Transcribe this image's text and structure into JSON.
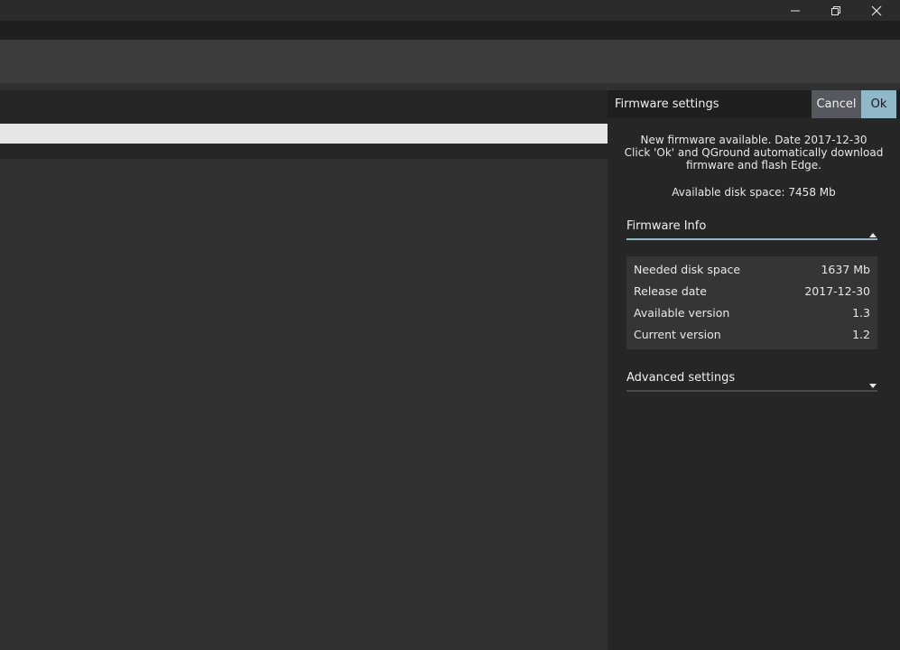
{
  "window": {
    "controls": [
      "minimize-icon",
      "restore-icon",
      "close-icon"
    ]
  },
  "firmware_panel": {
    "title": "Firmware settings",
    "cancel_label": "Cancel",
    "ok_label": "Ok",
    "message_line1": "New firmware available. Date 2017-12-30",
    "message_line2": "Click 'Ok' and QGround automatically download",
    "message_line3": "firmware and flash Edge.",
    "disk_space": "Available disk space: 7458 Mb",
    "firmware_info": {
      "label": "Firmware Info",
      "expanded": true,
      "rows": [
        {
          "key": "Needed disk space",
          "value": "1637 Mb"
        },
        {
          "key": "Release date",
          "value": "2017-12-30"
        },
        {
          "key": "Available version",
          "value": "1.3"
        },
        {
          "key": "Current version",
          "value": "1.2"
        }
      ]
    },
    "advanced": {
      "label": "Advanced settings",
      "expanded": false
    }
  },
  "colors": {
    "accent": "#8fb8c8",
    "cancel_bg": "#57575f",
    "background": "#303030",
    "panel_bg": "#262626"
  }
}
